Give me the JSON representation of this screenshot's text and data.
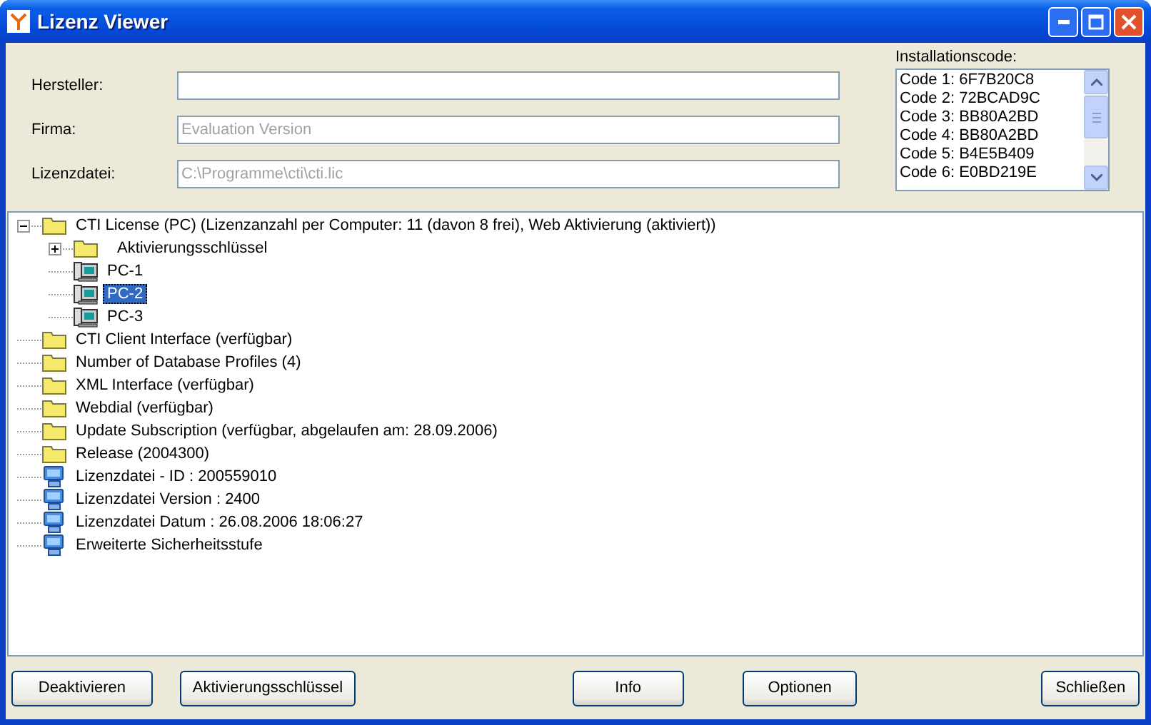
{
  "window": {
    "title": "Lizenz Viewer"
  },
  "fields": [
    {
      "label": "Hersteller:"
    },
    {
      "label": "Firma:",
      "value": "Evaluation Version",
      "disabled": true
    },
    {
      "label": "Lizenzdatei:",
      "value": "C:\\Programme\\cti\\cti.lic",
      "disabled": true
    }
  ],
  "installation_codes": {
    "label": "Installationscode:",
    "items": [
      "Code 1: 6F7B20C8",
      "Code 2: 72BCAD9C",
      "Code 3: BB80A2BD",
      "Code 4: BB80A2BD",
      "Code 5: B4E5B409",
      "Code 6: E0BD219E"
    ]
  },
  "tree": [
    {
      "kind": "folder",
      "label": "CTI License (PC) (Lizenzanzahl per Computer: 11 (davon 8 frei), Web Aktivierung (aktiviert))",
      "expanded": true,
      "selected": false,
      "children": [
        {
          "kind": "folder",
          "label": "Aktivierungsschlüssel",
          "expanded": false,
          "selected": false
        },
        {
          "kind": "computer",
          "label": "PC-1",
          "selected": false
        },
        {
          "kind": "computer",
          "label": "PC-2",
          "selected": true
        },
        {
          "kind": "computer",
          "label": "PC-3",
          "selected": false
        }
      ]
    },
    {
      "kind": "folder",
      "label": "CTI Client Interface (verfügbar)",
      "selected": false
    },
    {
      "kind": "folder",
      "label": "Number of Database Profiles (4)",
      "selected": false
    },
    {
      "kind": "folder",
      "label": "XML Interface (verfügbar)",
      "selected": false
    },
    {
      "kind": "folder",
      "label": "Webdial (verfügbar)",
      "selected": false
    },
    {
      "kind": "folder",
      "label": "Update Subscription (verfügbar, abgelaufen am: 28.09.2006)",
      "selected": false
    },
    {
      "kind": "folder",
      "label": "Release (2004300)",
      "selected": false
    },
    {
      "kind": "network",
      "label": "Lizenzdatei - ID : 200559010",
      "selected": false
    },
    {
      "kind": "network",
      "label": "Lizenzdatei Version : 2400",
      "selected": false
    },
    {
      "kind": "network",
      "label": "Lizenzdatei Datum : 26.08.2006 18:06:27",
      "selected": false
    },
    {
      "kind": "network",
      "label": "Erweiterte Sicherheitsstufe",
      "selected": false
    }
  ],
  "buttons": [
    "Deaktivieren",
    "Aktivierungsschlüssel",
    "Info",
    "Optionen",
    "Schließen"
  ]
}
